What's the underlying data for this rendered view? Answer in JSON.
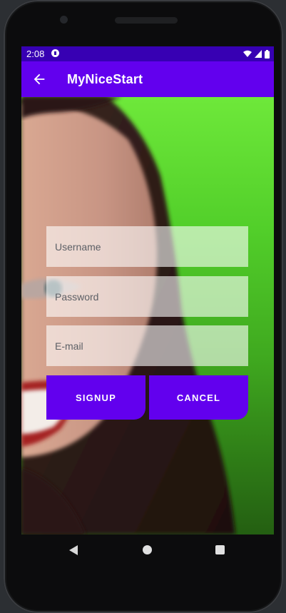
{
  "status_bar": {
    "time": "2:08",
    "app_icon": "notification-app-icon",
    "icons": [
      "wifi-icon",
      "signal-icon",
      "battery-icon"
    ]
  },
  "app_bar": {
    "back_icon": "arrow-back-icon",
    "title": "MyNiceStart"
  },
  "form": {
    "username_placeholder": "Username",
    "password_placeholder": "Password",
    "email_placeholder": "E-mail",
    "signup_label": "SIGNUP",
    "cancel_label": "CANCEL"
  },
  "nav_bar": {
    "icons": [
      "nav-back-icon",
      "nav-home-icon",
      "nav-recents-icon"
    ]
  },
  "colors": {
    "status_bar": "#3700b3",
    "primary": "#6200ee",
    "background_green": "#52cf2a"
  }
}
